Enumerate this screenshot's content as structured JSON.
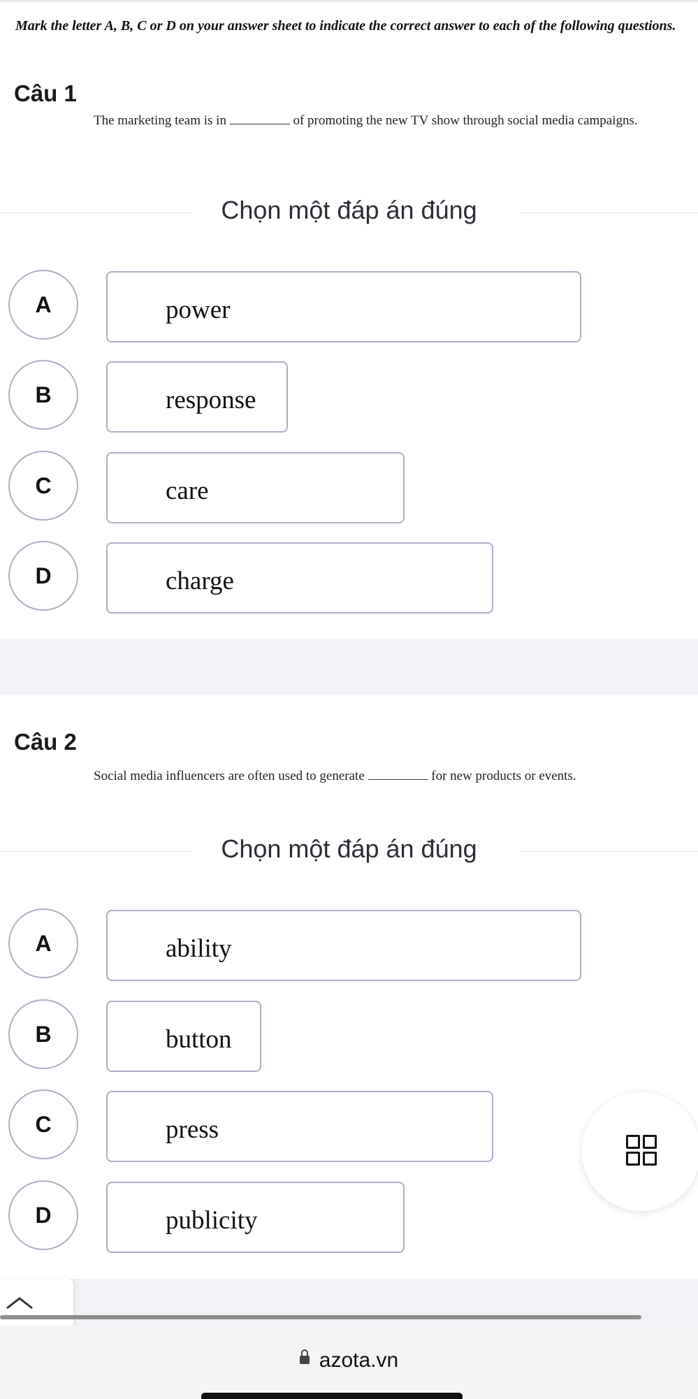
{
  "instruction": "Mark the letter A, B, C or D on your answer sheet to indicate the correct answer to each of the following questions.",
  "choose_label": "Chọn một đáp án đúng",
  "questions": [
    {
      "title": "Câu 1",
      "text_before": "The marketing team is in",
      "text_after": "of promoting the new TV show through social media campaigns.",
      "options": [
        {
          "letter": "A",
          "text": "power"
        },
        {
          "letter": "B",
          "text": "response"
        },
        {
          "letter": "C",
          "text": "care"
        },
        {
          "letter": "D",
          "text": "charge"
        }
      ]
    },
    {
      "title": "Câu 2",
      "text_before": "Social media influencers are often used to generate",
      "text_after": "for new products or events.",
      "options": [
        {
          "letter": "A",
          "text": "ability"
        },
        {
          "letter": "B",
          "text": "button"
        },
        {
          "letter": "C",
          "text": "press"
        },
        {
          "letter": "D",
          "text": "publicity"
        }
      ]
    }
  ],
  "browser": {
    "url": "azota.vn"
  },
  "colors": {
    "border": "#a9b1c4",
    "gap": "#f0f2f6"
  }
}
